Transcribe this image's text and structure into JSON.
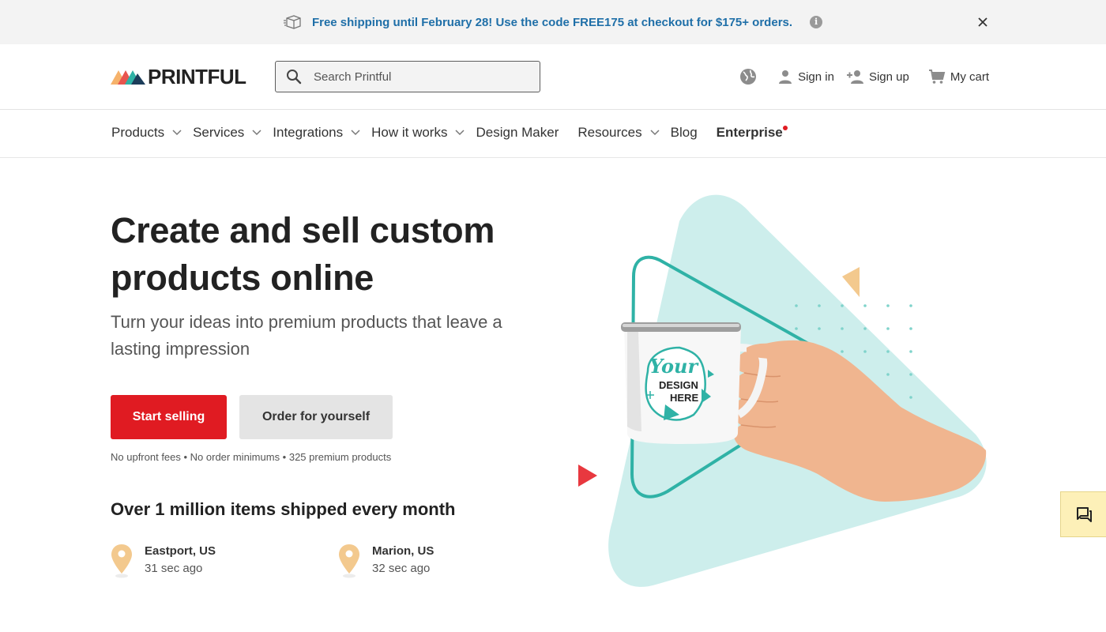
{
  "promo": {
    "text": "Free shipping until February 28! Use the code FREE175 at checkout for $175+ orders.",
    "info_glyph": "i",
    "icons": [
      "box-icon",
      "info-icon",
      "close-icon"
    ]
  },
  "header": {
    "logo_text": "PRINTFUL",
    "search_placeholder": "Search Printful",
    "sign_in": "Sign in",
    "sign_up": "Sign up",
    "cart": "My cart"
  },
  "nav": {
    "items": [
      {
        "label": "Products",
        "dropdown": true
      },
      {
        "label": "Services",
        "dropdown": true
      },
      {
        "label": "Integrations",
        "dropdown": true
      },
      {
        "label": "How it works",
        "dropdown": true
      },
      {
        "label": "Design Maker",
        "dropdown": false
      },
      {
        "label": "Resources",
        "dropdown": true
      },
      {
        "label": "Blog",
        "dropdown": false
      },
      {
        "label": "Enterprise",
        "dropdown": false
      }
    ]
  },
  "hero": {
    "title": "Create and sell custom products online",
    "subtitle": "Turn your ideas into premium products that leave a lasting impression",
    "primary_cta": "Start selling",
    "secondary_cta": "Order for yourself",
    "perks": "No upfront fees • No order minimums • 325 premium products",
    "shipped_heading": "Over 1 million items shipped every month",
    "locations": [
      {
        "city": "Eastport, US",
        "time": "31 sec ago"
      },
      {
        "city": "Marion, US",
        "time": "32 sec ago"
      }
    ],
    "mug_text": {
      "line1": "Your",
      "line2": "DESIGN",
      "line3": "HERE"
    }
  },
  "colors": {
    "brand_red": "#e01b22",
    "promo_blue": "#1f6fa8",
    "mint": "#cdeeec",
    "teal": "#2fb2a6",
    "peach": "#f3c98e"
  }
}
